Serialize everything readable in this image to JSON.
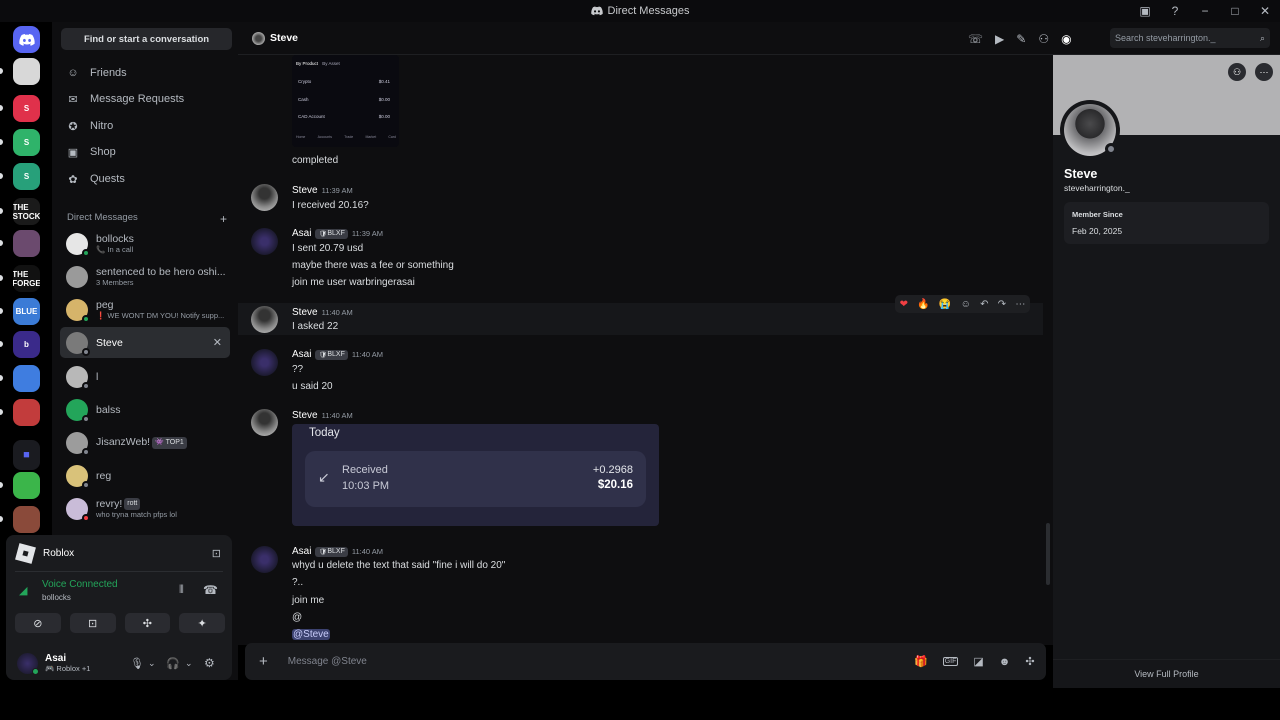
{
  "window": {
    "title": "Direct Messages",
    "controls": [
      "−",
      "□",
      "✕"
    ]
  },
  "guilds": [
    {
      "icon": "discord-logo-icon",
      "color": "#5865f2",
      "label": ""
    },
    {
      "icon": "server-icon-bw-art",
      "color": "#d8d8d8",
      "label": ""
    },
    {
      "icon": "server-icon-red-s",
      "color": "#e0314b",
      "label": "S"
    },
    {
      "icon": "server-icon-green-s",
      "color": "#2fb36a",
      "label": "S"
    },
    {
      "icon": "server-icon-teal-s",
      "color": "#27a07a",
      "label": "S"
    },
    {
      "icon": "server-icon-the-stock",
      "color": "#1a1a1a",
      "label": "THE STOCK"
    },
    {
      "icon": "server-icon-anime",
      "color": "#6b4a6e",
      "label": ""
    },
    {
      "icon": "server-icon-the-forge",
      "color": "#111111",
      "label": "THE FORGE"
    },
    {
      "icon": "server-icon-blue-game",
      "color": "#3b7bd6",
      "label": "BLUE"
    },
    {
      "icon": "server-icon-purple-b",
      "color": "#3a2a8a",
      "label": "b"
    },
    {
      "icon": "server-icon-anime-2",
      "color": "#3f7de0",
      "label": ""
    },
    {
      "icon": "server-icon-characters",
      "color": "#c23c3c",
      "label": ""
    },
    {
      "icon": "folder-icon",
      "color": "#2b2d31",
      "label": ""
    },
    {
      "icon": "server-icon-frog",
      "color": "#3bb54a",
      "label": ""
    },
    {
      "icon": "server-icon-photo",
      "color": "#8a4a3a",
      "label": ""
    }
  ],
  "sidebar": {
    "search_label": "Find or start a conversation",
    "nav": [
      {
        "label": "Friends",
        "icon": "friends-icon",
        "glyph": "☺"
      },
      {
        "label": "Message Requests",
        "icon": "mail-icon",
        "glyph": "✉"
      },
      {
        "label": "Nitro",
        "icon": "nitro-icon",
        "glyph": "✪"
      },
      {
        "label": "Shop",
        "icon": "shop-icon",
        "glyph": "▣"
      },
      {
        "label": "Quests",
        "icon": "quests-icon",
        "glyph": "✿"
      }
    ],
    "dm_header": "Direct Messages",
    "dm_add": "+",
    "dms": [
      {
        "name": "bollocks",
        "sub": "📞 In a call",
        "color": "#e6e6e6",
        "status": "#23a55a"
      },
      {
        "name": "sentenced to be hero oshi...",
        "sub": "3 Members",
        "color": "#9a9a9a",
        "status": ""
      },
      {
        "name": "peg",
        "sub": "❗ WE WONT DM YOU! Notify supp...",
        "color": "#d6b46a",
        "status": "#23a55a"
      },
      {
        "name": "Steve",
        "sub": "",
        "color": "#7a7a7a",
        "status": "#80848e"
      },
      {
        "name": "l",
        "sub": "",
        "color": "#b8b8b8",
        "status": "#80848e"
      },
      {
        "name": "balss",
        "sub": "",
        "color": "#23a55a",
        "status": "#80848e"
      },
      {
        "name": "JisanzWeb!",
        "sub": "",
        "tag": "👾 TOP1",
        "color": "#9c9c9c",
        "status": "#80848e"
      },
      {
        "name": "reg",
        "sub": "",
        "color": "#d9c27a",
        "status": "#80848e"
      },
      {
        "name": "revry!",
        "sub": "who tryna match pfps lol",
        "tag": "rott",
        "color": "#c9bcd8",
        "status": "#f23f43"
      }
    ],
    "close_glyph": "✕"
  },
  "user_panel": {
    "activity": "Roblox",
    "voice_status": "Voice Connected",
    "voice_channel": "bollocks",
    "username": "Asai",
    "user_status": "🎮 Roblox +1",
    "btn_glyphs": [
      "⊘",
      "⊡",
      "✣",
      "✦"
    ]
  },
  "chat": {
    "header_name": "Steve",
    "search_placeholder": "Search steveharrington._",
    "first_line": "completed",
    "messages": [
      {
        "author": "Steve",
        "time": "11:39 AM",
        "lines": [
          "I received 20.16?"
        ]
      },
      {
        "author": "Asai",
        "badge": "BLXF",
        "time": "11:39 AM",
        "lines": [
          "I sent 20.79 usd",
          "maybe there was a fee or something",
          "join me user warbringerasai"
        ]
      },
      {
        "author": "Steve",
        "time": "11:40 AM",
        "lines": [
          "I asked 22"
        ]
      },
      {
        "author": "Asai",
        "badge": "BLXF",
        "time": "11:40 AM",
        "lines": [
          "??",
          "u said 20"
        ]
      },
      {
        "author": "Steve",
        "time": "11:40 AM",
        "lines": []
      },
      {
        "author": "Asai",
        "badge": "BLXF",
        "time": "11:40 AM",
        "lines": [
          "whyd u delete the text that said \"fine i will do 20\"",
          "?..",
          "join me",
          "@",
          "@Steve"
        ]
      }
    ],
    "card": {
      "title": "Today",
      "label": "Received",
      "time": "10:03 PM",
      "amount_crypto": "+0.2968",
      "amount_usd": "$20.16"
    },
    "preview": {
      "tabs": [
        "By Product",
        "By Asset"
      ],
      "rows": [
        {
          "name": "Crypto",
          "value": "$0.41"
        },
        {
          "name": "Cash",
          "value": "$0.00"
        },
        {
          "name": "CAD Account",
          "value": "$0.00"
        }
      ],
      "nav": [
        "Home",
        "Accounts",
        "Trade",
        "Market",
        "Card"
      ]
    },
    "composer_placeholder": "Message @Steve",
    "reactions": [
      "❤",
      "🔥",
      "😭"
    ]
  },
  "profile": {
    "display_name": "Steve",
    "username": "steveharrington._",
    "member_since_label": "Member Since",
    "member_since": "Feb 20, 2025",
    "view_full": "View Full Profile"
  }
}
